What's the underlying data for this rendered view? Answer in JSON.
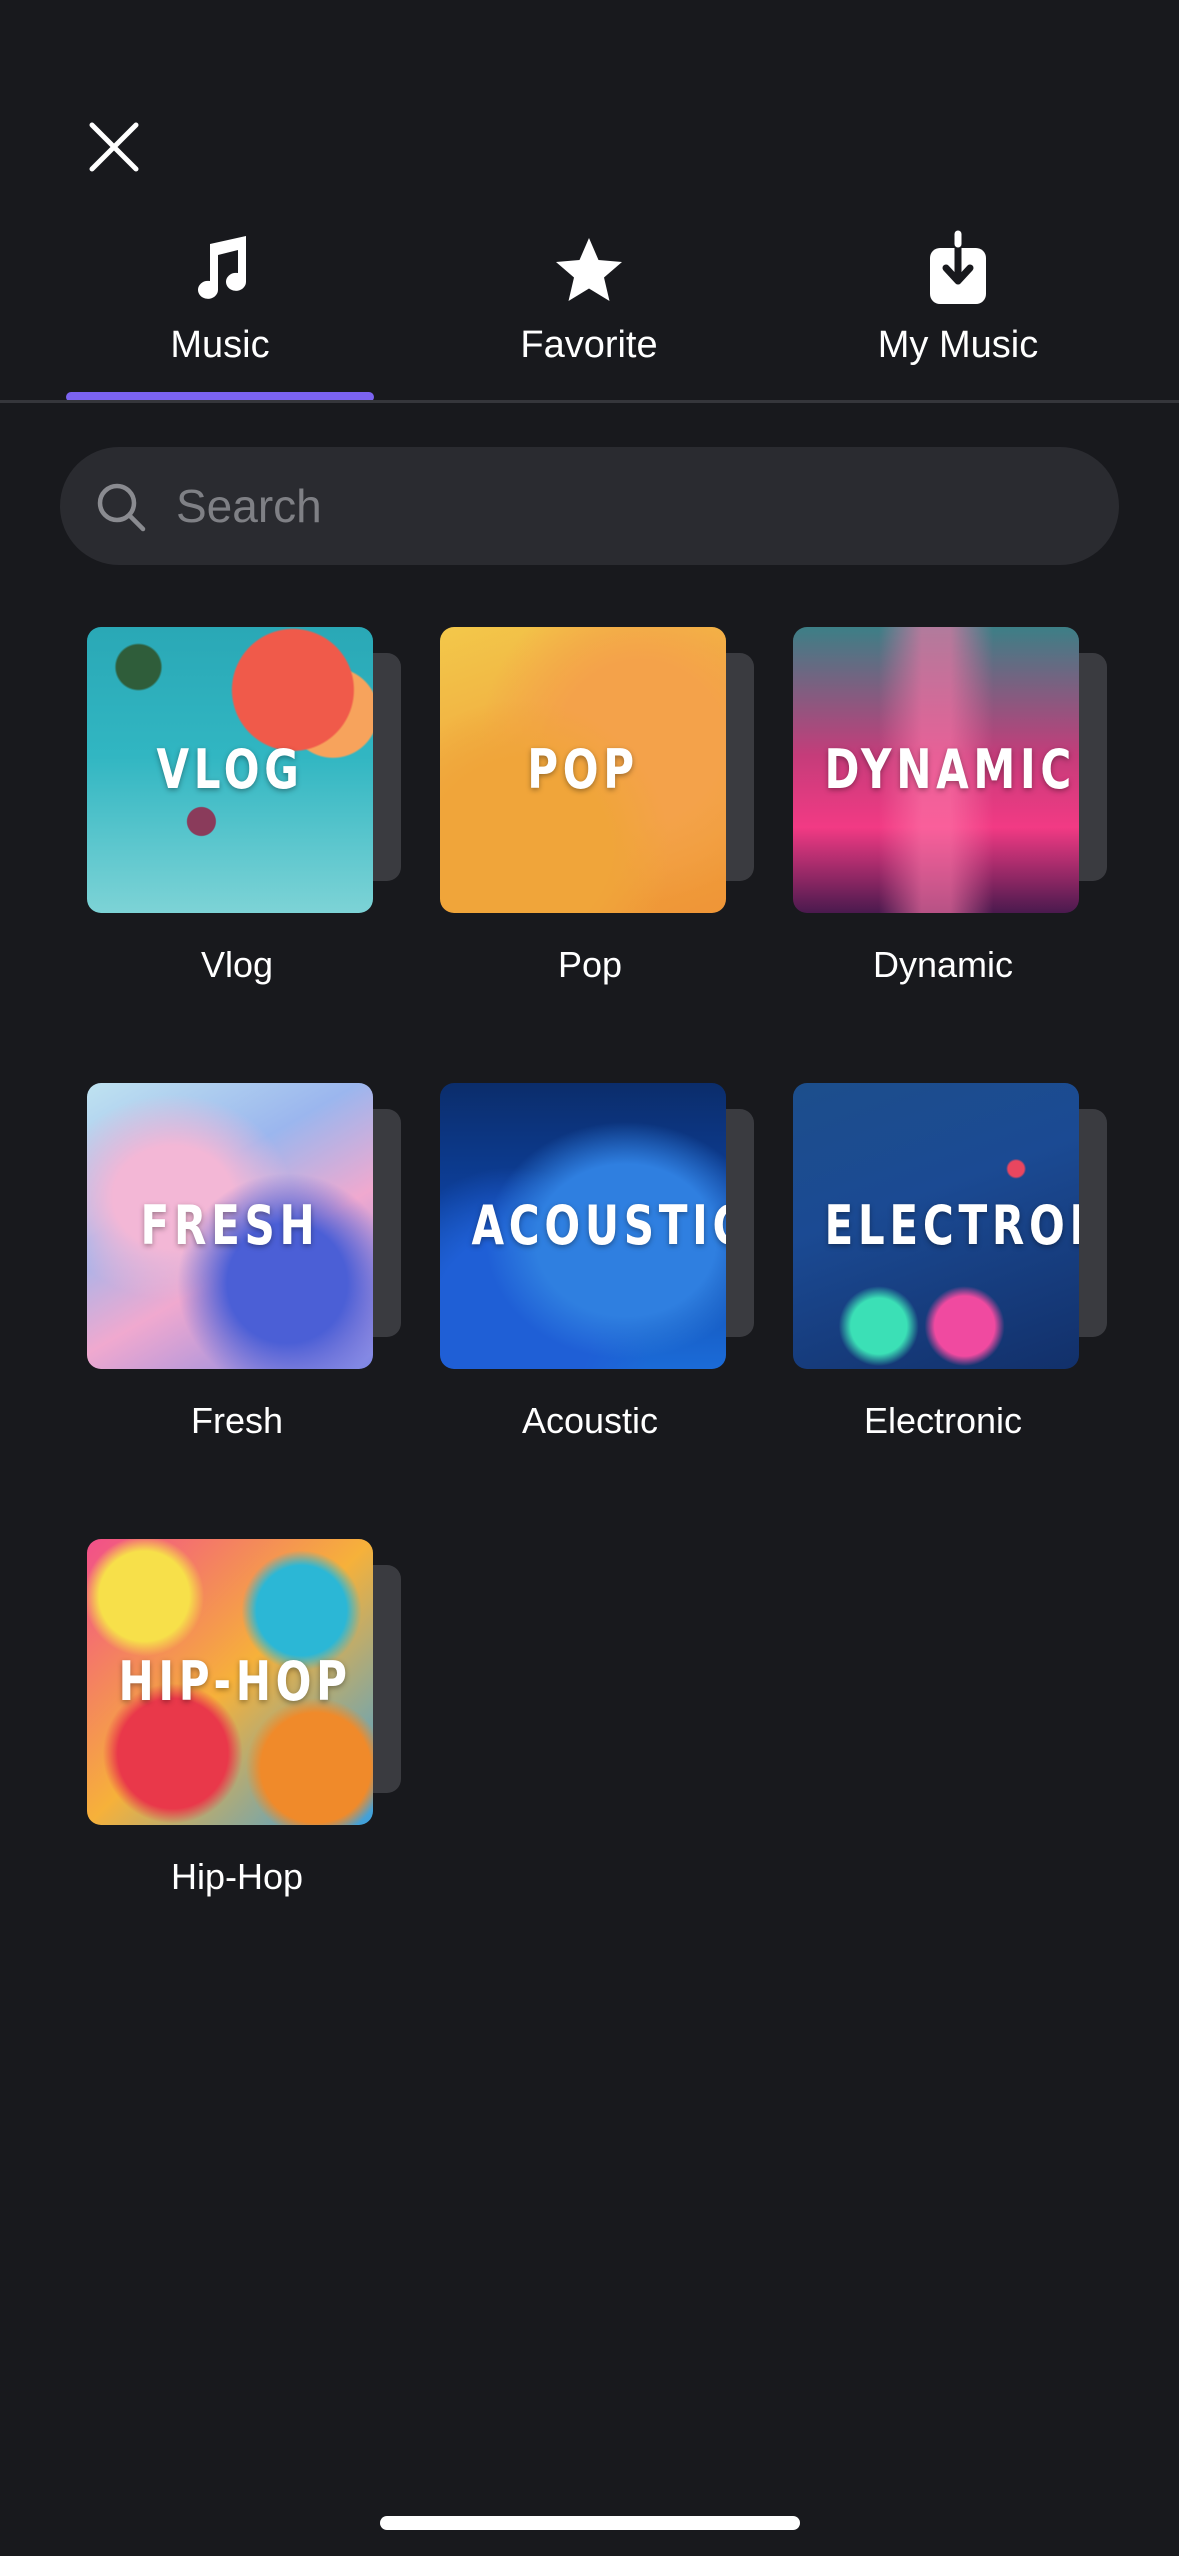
{
  "header": {
    "close_icon": "close-icon"
  },
  "tabs": [
    {
      "label": "Music",
      "icon": "music-note-icon",
      "selected": true
    },
    {
      "label": "Favorite",
      "icon": "star-icon",
      "selected": false
    },
    {
      "label": "My Music",
      "icon": "download-icon",
      "selected": false
    }
  ],
  "colors": {
    "accent": "#7b63f0",
    "background": "#18191d",
    "search_bg": "#2a2b30"
  },
  "search": {
    "placeholder": "Search",
    "value": ""
  },
  "categories": [
    {
      "cover_text": "VLOG",
      "label": "Vlog"
    },
    {
      "cover_text": "POP",
      "label": "Pop"
    },
    {
      "cover_text": "DYNAMIC",
      "label": "Dynamic"
    },
    {
      "cover_text": "FRESH",
      "label": "Fresh"
    },
    {
      "cover_text": "ACOUSTIC",
      "label": "Acoustic"
    },
    {
      "cover_text": "ELECTRONIC",
      "label": "Electronic"
    },
    {
      "cover_text": "HIP-HOP",
      "label": "Hip-Hop"
    }
  ]
}
